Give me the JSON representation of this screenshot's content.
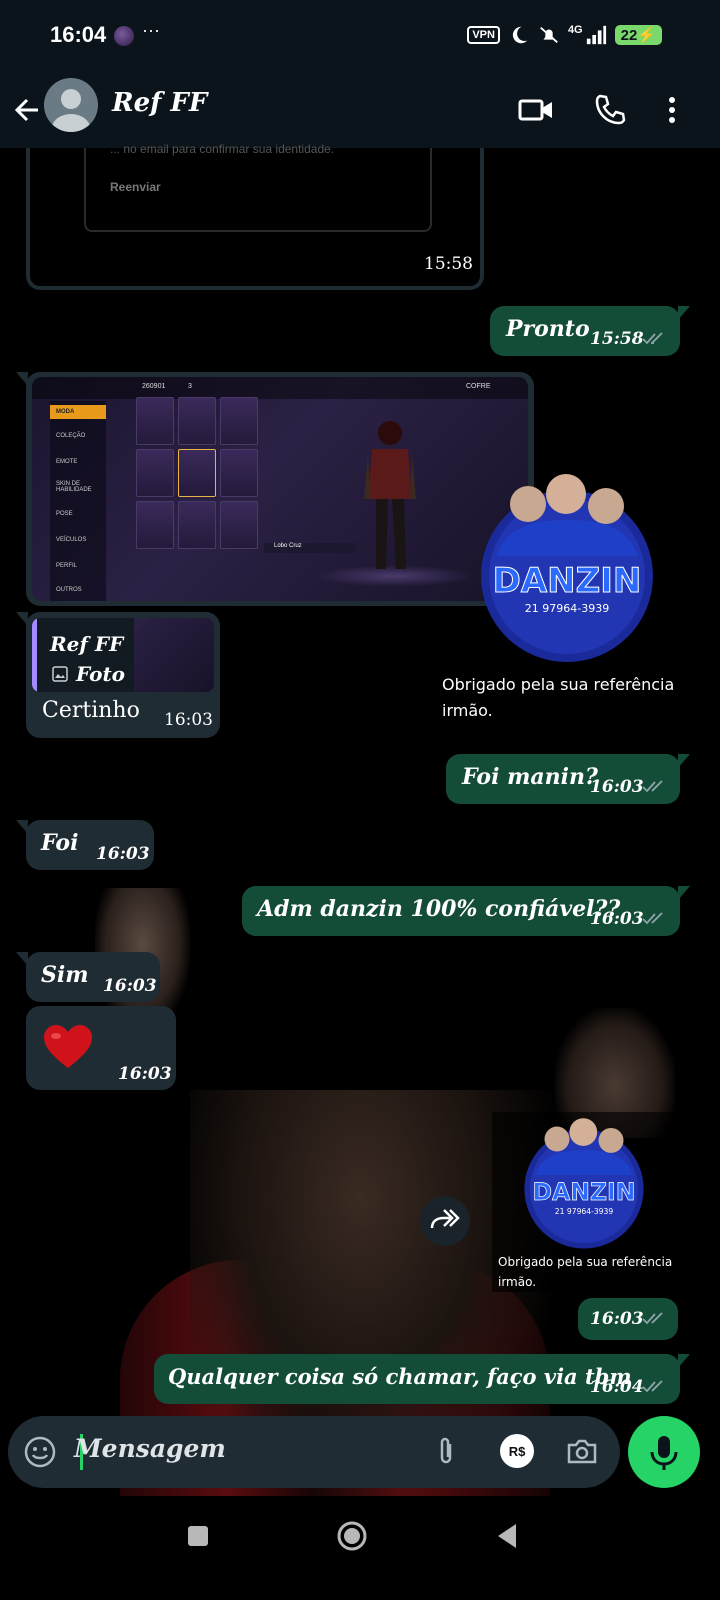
{
  "status_bar": {
    "time": "16:04",
    "more": "···",
    "vpn": "VPN",
    "network": "4G",
    "battery": "22"
  },
  "header": {
    "contact_name": "Ref FF"
  },
  "messages": {
    "prev_image_faint": "... no email para confirmar sua identidade.",
    "prev_image_resend": "Reenviar",
    "prev_image_time": "15:58",
    "pronto": {
      "text": "Pronto",
      "time": "15:58"
    },
    "game_screenshot": {
      "top_coins": "260901",
      "top_gems": "3",
      "vault": "COFRE",
      "menu": [
        "MODA",
        "COLEÇÃO",
        "EMOTE",
        "SKIN DE HABILIDADE",
        "POSE",
        "VEÍCULOS",
        "PERFIL",
        "OUTROS"
      ],
      "item_label": "Lobo Cruz"
    },
    "sticker_big": {
      "brand": "DANZIN",
      "phone": "21 97964-3939",
      "caption": "Obrigado pela sua referência irmão."
    },
    "reply": {
      "quote_author": "Ref FF",
      "quote_type": "Foto",
      "text": "Certinho",
      "time": "16:03"
    },
    "foi_manin": {
      "text": "Foi manin?",
      "time": "16:03"
    },
    "foi": {
      "text": "Foi",
      "time": "16:03"
    },
    "adm": {
      "text": "Adm danzin 100% confiável??",
      "time": "16:03"
    },
    "sim": {
      "text": "Sim",
      "time": "16:03"
    },
    "heart": {
      "emoji": "❤️",
      "time": "16:03"
    },
    "sticker_small": {
      "brand": "DANZIN",
      "phone": "21 97964-3939",
      "caption": "Obrigado pela sua referência irmão.",
      "time": "16:03"
    },
    "qualquer": {
      "text": "Qualquer coisa só chamar, faço via tbm",
      "time": "16:04"
    }
  },
  "input": {
    "placeholder": "Mensagem",
    "currency": "R$"
  },
  "colors": {
    "header_bg": "#0b141a",
    "incoming_bubble": "#202c33",
    "outgoing_bubble": "#144d37",
    "accent_green": "#25d366"
  }
}
